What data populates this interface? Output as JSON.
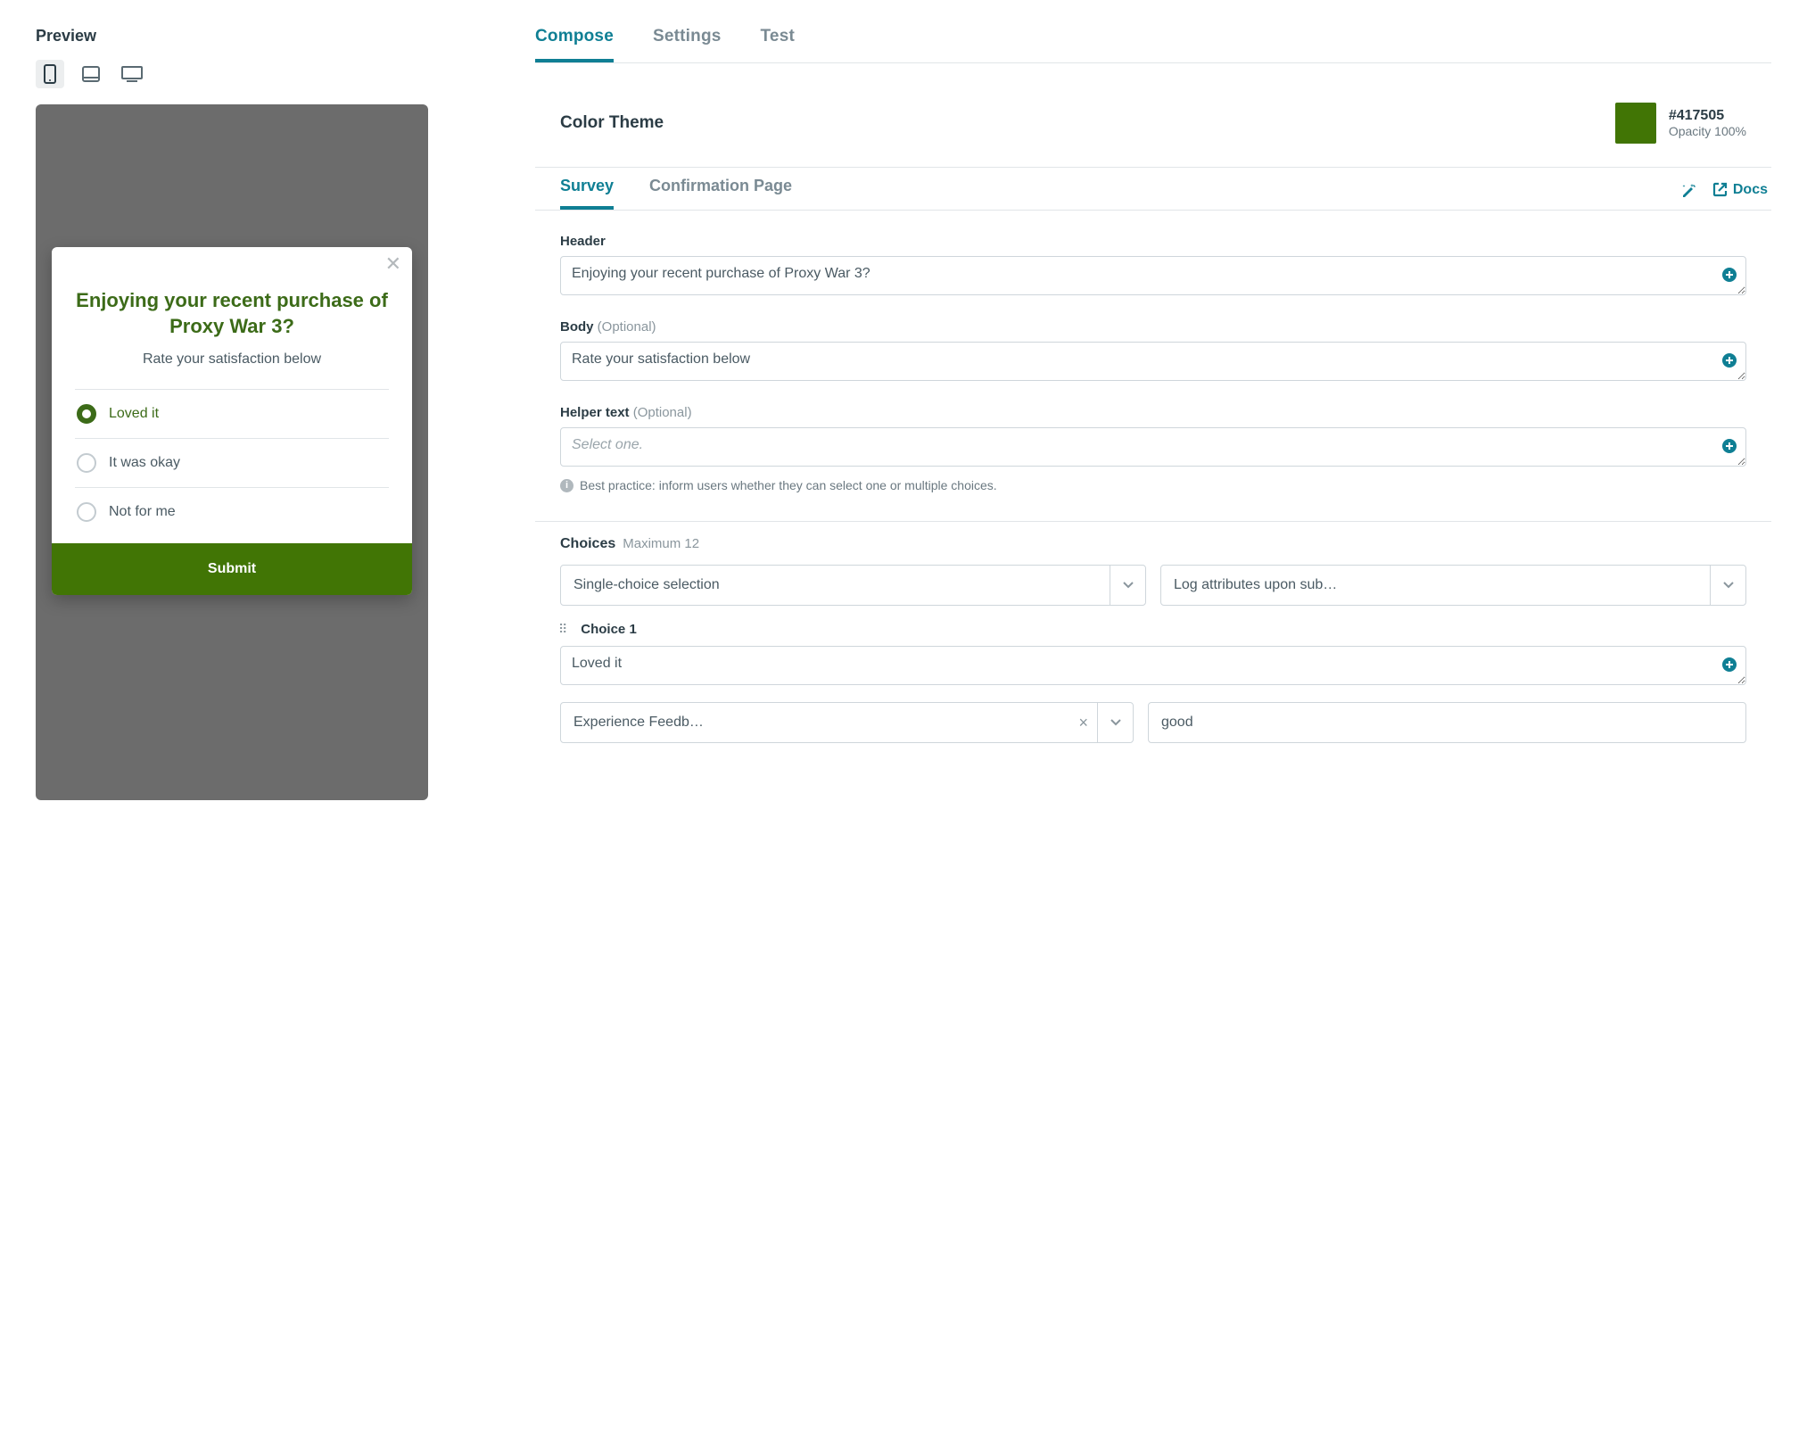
{
  "preview": {
    "title": "Preview",
    "survey": {
      "header": "Enjoying your recent purchase of Proxy War 3?",
      "body": "Rate your satisfaction below",
      "choices": [
        {
          "label": "Loved it",
          "selected": true
        },
        {
          "label": "It was okay",
          "selected": false
        },
        {
          "label": "Not for me",
          "selected": false
        }
      ],
      "submit": "Submit"
    }
  },
  "tabs": {
    "compose": "Compose",
    "settings": "Settings",
    "test": "Test"
  },
  "theme": {
    "title": "Color Theme",
    "hex": "#417505",
    "opacity": "Opacity 100%"
  },
  "subtabs": {
    "survey": "Survey",
    "confirmation": "Confirmation Page",
    "docs": "Docs"
  },
  "fields": {
    "header_label": "Header",
    "header_value": "Enjoying your recent purchase of Proxy War 3?",
    "body_label": "Body",
    "body_opt": "(Optional)",
    "body_value": "Rate your satisfaction below",
    "helper_label": "Helper text",
    "helper_opt": "(Optional)",
    "helper_placeholder": "Select one.",
    "helper_hint": "Best practice: inform users whether they can select one or multiple choices."
  },
  "choices": {
    "title": "Choices",
    "max": "Maximum 12",
    "selection_type": "Single-choice selection",
    "log_attr": "Log attributes upon sub…",
    "choice1_label": "Choice 1",
    "choice1_value": "Loved it",
    "choice1_tag": "Experience Feedb…",
    "choice1_attr_value": "good"
  }
}
